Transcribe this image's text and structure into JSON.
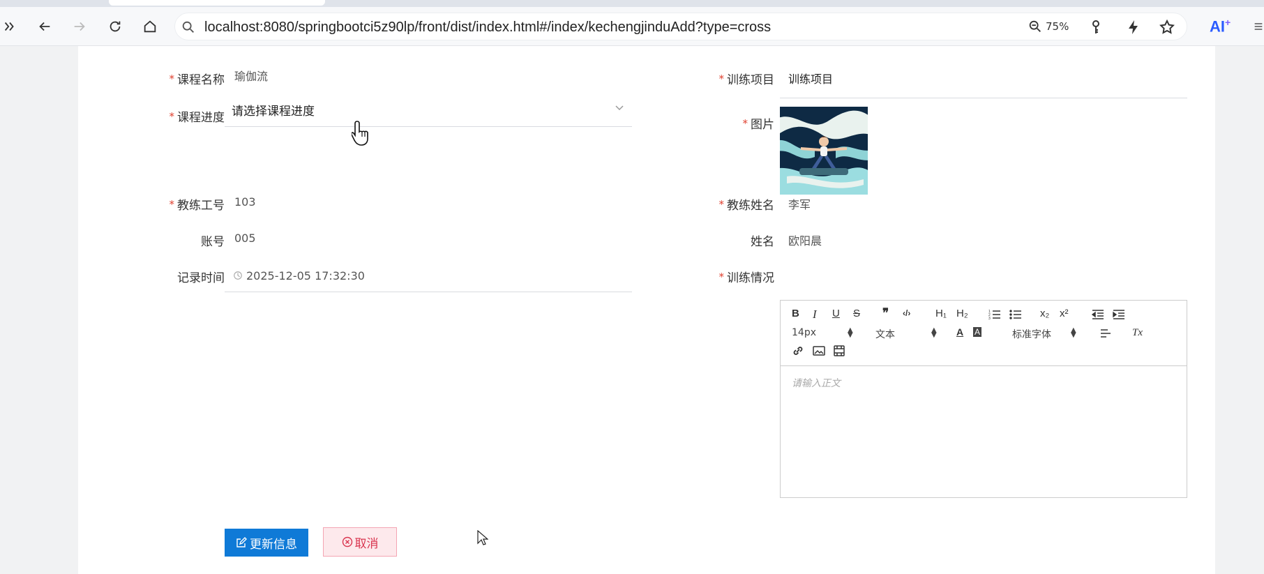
{
  "browser": {
    "url": "localhost:8080/springbootci5z90lp/front/dist/index.html#/index/kechengjinduAdd?type=cross",
    "zoom": "75%",
    "ai_label": "AI",
    "ai_sup": "+"
  },
  "form": {
    "course_name_label": "课程名称",
    "course_name_value": "瑜伽流",
    "training_item_label": "训练项目",
    "training_item_value": "训练项目",
    "progress_label": "课程进度",
    "progress_placeholder": "请选择课程进度",
    "image_label": "图片",
    "coach_id_label": "教练工号",
    "coach_id_value": "103",
    "coach_name_label": "教练姓名",
    "coach_name_value": "李军",
    "account_label": "账号",
    "account_value": "005",
    "name_label": "姓名",
    "name_value": "欧阳晨",
    "record_time_label": "记录时间",
    "record_time_value": "2025-12-05 17:32:30",
    "training_status_label": "训练情况",
    "required_mark": "*"
  },
  "editor": {
    "font_size": "14px",
    "block_type": "文本",
    "font_family": "标准字体",
    "placeholder": "请输入正文",
    "bold": "B",
    "italic": "I",
    "underline": "U",
    "strike": "S",
    "quote": "❞",
    "code": "‹/›",
    "h1": "H₁",
    "h2": "H₂",
    "sub": "x₂",
    "sup": "x²",
    "clean": "Tx"
  },
  "buttons": {
    "update": "更新信息",
    "cancel": "取消"
  },
  "colors": {
    "primary": "#0f7ad7",
    "cancel_bg": "#fde9ec",
    "cancel_text": "#d9354f",
    "required": "#e0402f"
  }
}
